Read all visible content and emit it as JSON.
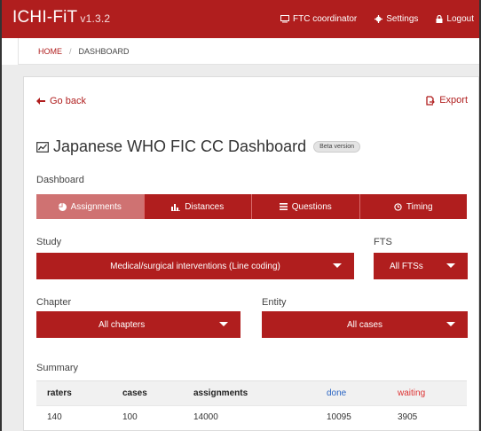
{
  "app": {
    "name": "ICHI-FiT",
    "version": "v1.3.2"
  },
  "nav": {
    "coordinator": "FTC coordinator",
    "settings": "Settings",
    "logout": "Logout"
  },
  "breadcrumb": {
    "home": "HOME",
    "separator": "/",
    "current": "DASHBOARD"
  },
  "actions": {
    "go_back": "Go back",
    "export": "Export"
  },
  "page": {
    "title": "Japanese WHO FIC CC Dashboard",
    "badge": "Beta version"
  },
  "dashboard": {
    "label": "Dashboard",
    "tabs": [
      {
        "label": "Assignments",
        "icon": "pie-chart-icon",
        "active": true
      },
      {
        "label": "Distances",
        "icon": "bar-chart-icon",
        "active": false
      },
      {
        "label": "Questions",
        "icon": "list-icon",
        "active": false
      },
      {
        "label": "Timing",
        "icon": "clock-icon",
        "active": false
      }
    ]
  },
  "filters": {
    "study_label": "Study",
    "study_value": "Medical/surgical interventions (Line coding)",
    "fts_label": "FTS",
    "fts_value": "All FTSs",
    "chapter_label": "Chapter",
    "chapter_value": "All chapters",
    "entity_label": "Entity",
    "entity_value": "All cases"
  },
  "summary": {
    "label": "Summary",
    "headers": [
      "raters",
      "cases",
      "assignments",
      "done",
      "waiting"
    ],
    "rows": [
      [
        "140",
        "100",
        "14000",
        "10095",
        "3905"
      ]
    ]
  },
  "colors": {
    "brand": "#b01e1e",
    "active_tab": "#cf7272",
    "done": "#2b66c4",
    "waiting": "#dd3333"
  }
}
